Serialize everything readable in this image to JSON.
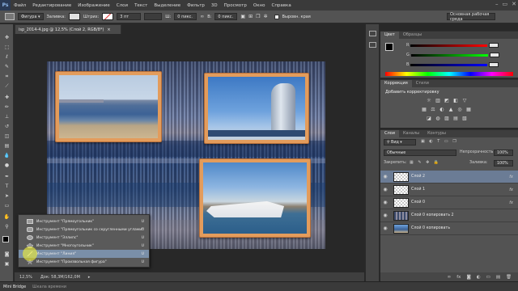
{
  "app": {
    "logo": "Ps",
    "menu": [
      "Файл",
      "Редактирование",
      "Изображение",
      "Слои",
      "Текст",
      "Выделение",
      "Фильтр",
      "3D",
      "Просмотр",
      "Окно",
      "Справка"
    ],
    "window_controls": [
      "–",
      "▭",
      "✕"
    ]
  },
  "options_bar": {
    "tool_mode": "Фигура",
    "fill_label": "Заливка:",
    "stroke_label": "Штрих:",
    "stroke_width": "3 пт",
    "w_label": "Ш:",
    "w_value": "0 пикс.",
    "h_label": "В:",
    "h_value": "0 пикс.",
    "align_edges": "Выровн. края",
    "workspace": "Основная рабочая среда",
    "fill_color": "#e0e0e0",
    "stroke_color": "#ffffff"
  },
  "document": {
    "tab_title": "isp_2014-4.jpg @ 12,5% (Слой 2, RGB/8*)",
    "tab_close": "×",
    "zoom": "12,5%",
    "doc_size": "Док: 58,3M/162,0M"
  },
  "tool_flyout": {
    "items": [
      {
        "label": "Инструмент \"Прямоугольник\"",
        "key": "U",
        "selected": false
      },
      {
        "label": "Инструмент \"Прямоугольник со скругленными углами\"",
        "key": "U",
        "selected": false
      },
      {
        "label": "Инструмент \"Эллипс\"",
        "key": "U",
        "selected": false
      },
      {
        "label": "Инструмент \"Многоугольник\"",
        "key": "U",
        "selected": false
      },
      {
        "label": "Инструмент \"Линия\"",
        "key": "U",
        "selected": true
      },
      {
        "label": "Инструмент \"Произвольная фигура\"",
        "key": "U",
        "selected": false
      }
    ]
  },
  "bottom_bar": {
    "mini_bridge": "Mini Bridge",
    "timeline": "Шкала времени"
  },
  "color_panel": {
    "tabs": [
      "Цвет",
      "Образцы"
    ],
    "channels": [
      {
        "name": "R",
        "value": ""
      },
      {
        "name": "G",
        "value": ""
      },
      {
        "name": "B",
        "value": ""
      }
    ]
  },
  "adjustments_panel": {
    "tabs": [
      "Коррекция",
      "Стили"
    ],
    "title": "Добавить корректировку",
    "icons_row1": [
      "☼",
      "▥",
      "◩",
      "◧",
      "▽"
    ],
    "icons_row2": [
      "▦",
      "⚖",
      "◐",
      "▲",
      "◎",
      "▦"
    ],
    "icons_row3": [
      "◪",
      "◍",
      "▨",
      "▤",
      "▧"
    ]
  },
  "layers_panel": {
    "tabs": [
      "Слои",
      "Каналы",
      "Контуры"
    ],
    "filter_label": "Вид",
    "blend_mode": "Обычные",
    "opacity_label": "Непрозрачность:",
    "opacity_value": "100%",
    "lock_label": "Закрепить:",
    "fill_label": "Заливка:",
    "fill_value": "100%",
    "layers": [
      {
        "name": "Слой 2",
        "fx": "fx",
        "selected": true,
        "thumb": "checker"
      },
      {
        "name": "Слой 1",
        "fx": "fx",
        "selected": false,
        "thumb": "checker"
      },
      {
        "name": "Слой 0",
        "fx": "fx",
        "selected": false,
        "thumb": "checker"
      },
      {
        "name": "Слой 0 копировать 2",
        "fx": "",
        "selected": false,
        "thumb": "photo"
      },
      {
        "name": "Слой 0 копировать",
        "fx": "",
        "selected": false,
        "thumb": "photo"
      }
    ],
    "footer_icons": [
      "∞",
      "fx",
      "◙",
      "◐",
      "▭",
      "▤",
      "🗑"
    ]
  }
}
